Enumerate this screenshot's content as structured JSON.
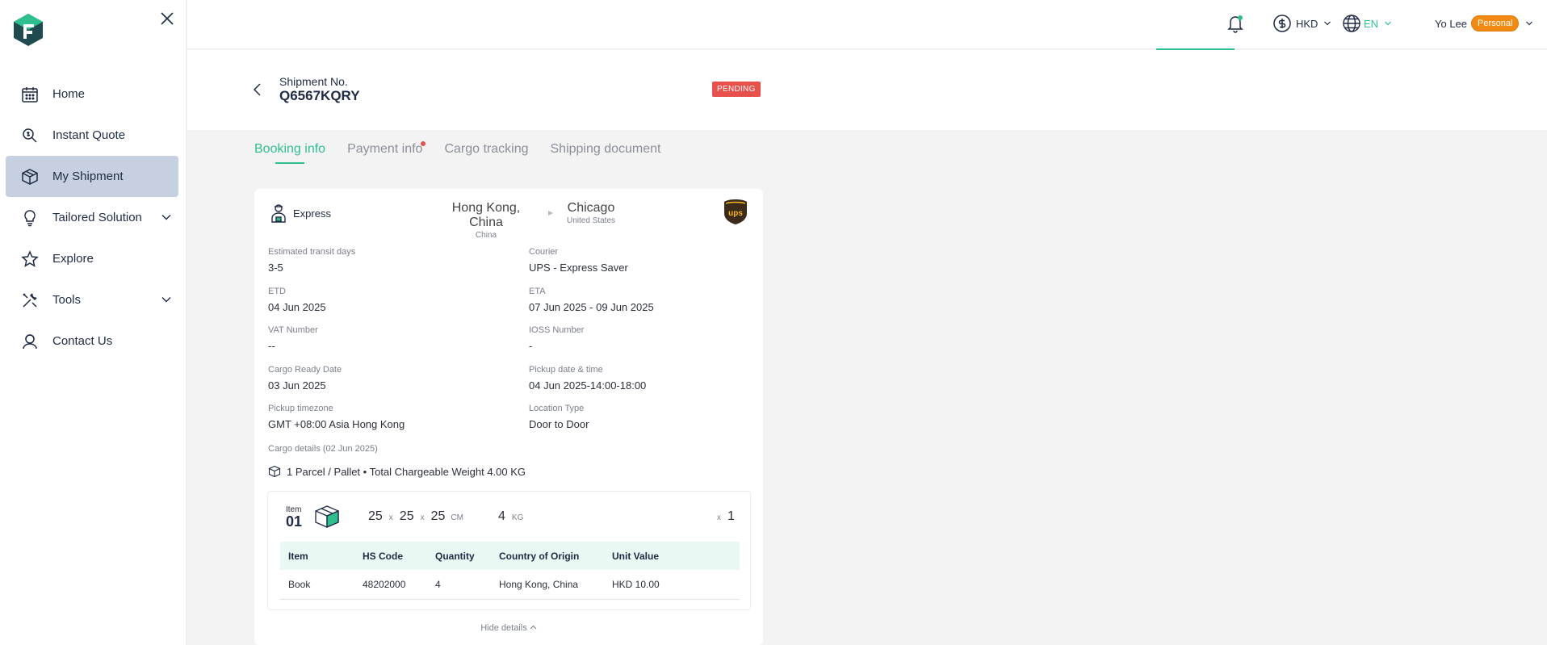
{
  "sidebar": {
    "items": [
      {
        "label": "Home",
        "icon": "calendar-icon"
      },
      {
        "label": "Instant Quote",
        "icon": "quote-search-icon"
      },
      {
        "label": "My Shipment",
        "icon": "box-icon"
      },
      {
        "label": "Tailored Solution",
        "icon": "lightbulb-icon"
      },
      {
        "label": "Explore",
        "icon": "star-icon"
      },
      {
        "label": "Tools",
        "icon": "tools-icon"
      },
      {
        "label": "Contact Us",
        "icon": "support-agent-icon"
      }
    ]
  },
  "topbar": {
    "currency": "HKD",
    "language": "EN",
    "user_name": "Yo Lee",
    "account_type": "Personal"
  },
  "shipment": {
    "label": "Shipment No.",
    "number": "Q6567KQRY",
    "status": "PENDING"
  },
  "tabs": [
    "Booking info",
    "Payment info",
    "Cargo tracking",
    "Shipping document"
  ],
  "booking": {
    "service": "Express",
    "origin_city": "Hong Kong, China",
    "origin_country": "China",
    "destination_city": "Chicago",
    "destination_country": "United States",
    "carrier_logo": "ups",
    "fields": [
      {
        "label": "Estimated transit days",
        "value": "3-5"
      },
      {
        "label": "Courier",
        "value": "UPS - Express Saver"
      },
      {
        "label": "ETD",
        "value": "04 Jun 2025"
      },
      {
        "label": "ETA",
        "value": "07 Jun 2025 - 09 Jun 2025"
      },
      {
        "label": "VAT Number",
        "value": "--"
      },
      {
        "label": "IOSS Number",
        "value": "-"
      },
      {
        "label": "Cargo Ready Date",
        "value": "03 Jun 2025"
      },
      {
        "label": "Pickup date & time",
        "value": "04 Jun 2025-14:00-18:00"
      },
      {
        "label": "Pickup timezone",
        "value": "GMT +08:00 Asia Hong Kong"
      },
      {
        "label": "Location Type",
        "value": "Door to Door"
      }
    ],
    "cargo_title": "Cargo details (02 Jun 2025)",
    "cargo_summary": "1 Parcel / Pallet • Total Chargeable Weight 4.00 KG",
    "item": {
      "label": "Item",
      "number": "01",
      "length": "25",
      "width": "25",
      "height": "25",
      "dim_x": "x",
      "dim_unit": "CM",
      "weight": "4",
      "weight_unit": "KG",
      "qty_x": "x",
      "qty": "1"
    },
    "table": {
      "headers": [
        "Item",
        "HS Code",
        "Quantity",
        "Country of Origin",
        "Unit Value"
      ],
      "rows": [
        [
          "Book",
          "48202000",
          "4",
          "Hong Kong, China",
          "HKD 10.00"
        ]
      ]
    },
    "hide_details": "Hide details"
  },
  "colors": {
    "accent": "#2fbf8f",
    "status": "#e8504c",
    "nav_active": "#c7d0e0",
    "personal_badge": "#f08a12"
  }
}
